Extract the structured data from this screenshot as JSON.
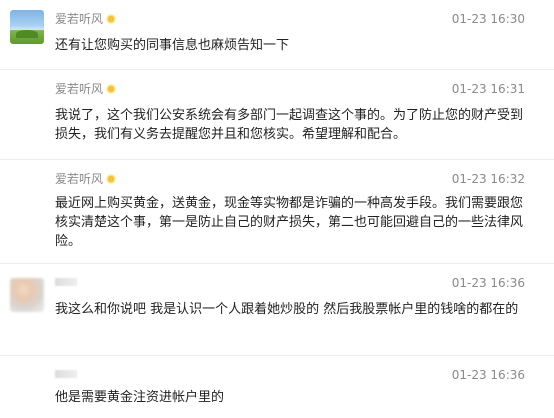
{
  "messages": [
    {
      "sender": "爱若听风",
      "time": "01-23 16:30",
      "text": "还有让您购买的同事信息也麻烦告知一下"
    },
    {
      "sender": "爱若听风",
      "time": "01-23 16:31",
      "text": "我说了，这个我们公安系统会有多部门一起调查这个事的。为了防止您的财产受到损失，我们有义务去提醒您并且和您核实。希望理解和配合。"
    },
    {
      "sender": "爱若听风",
      "time": "01-23 16:32",
      "text": "最近网上购买黄金，送黄金，现金等实物都是诈骗的一种高发手段。我们需要跟您核实清楚这个事，第一是防止自己的财产损失，第二也可能回避自己的一些法律风险。"
    },
    {
      "sender": "",
      "time": "01-23 16:36",
      "text": "我这么和你说吧 我是认识一个人跟着她炒股的 然后我股票帐户里的钱啥的都在的"
    },
    {
      "sender": "",
      "time": "01-23 16:36",
      "text": "他是需要黄金注资进帐户里的"
    }
  ],
  "icons": {
    "agent_badge": "sun-icon"
  },
  "colors": {
    "meta_text": "#8a8a8a",
    "body_text": "#222222",
    "divider": "#ececec"
  }
}
